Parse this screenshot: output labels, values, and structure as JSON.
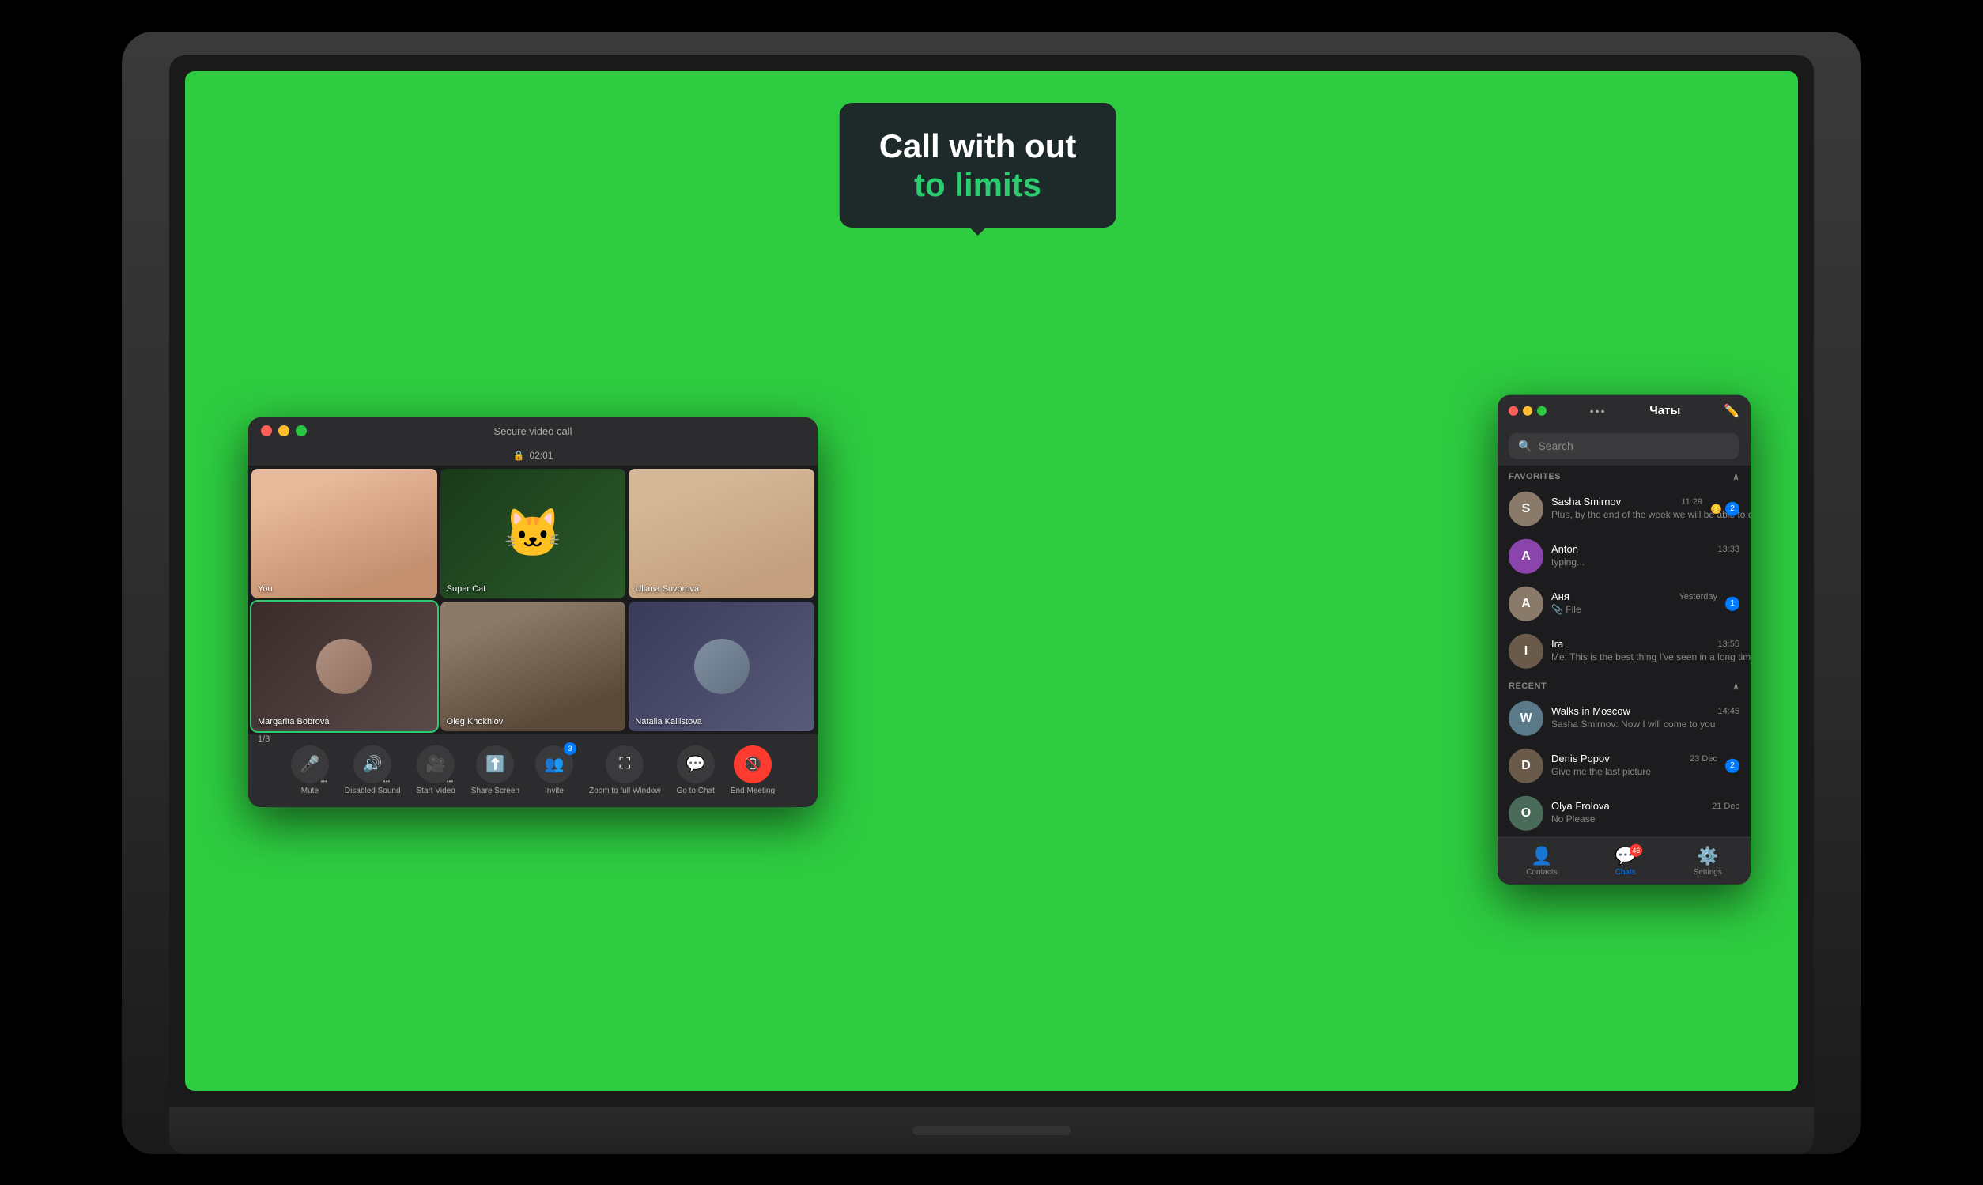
{
  "laptop": {
    "screen_bg": "#2ecc40"
  },
  "tooltip": {
    "line1": "Call with out",
    "line2": "to limits"
  },
  "video_call": {
    "titlebar_title": "Secure video call",
    "timer": "02:01",
    "page_indicator": "1/3",
    "participants": [
      {
        "id": "you",
        "label": "You",
        "type": "face"
      },
      {
        "id": "supercat",
        "label": "Super Cat",
        "type": "cat"
      },
      {
        "id": "uliana",
        "label": "Uliana Suvorova",
        "type": "face"
      },
      {
        "id": "margarita",
        "label": "Margarita Bobrova",
        "type": "avatar"
      },
      {
        "id": "oleg",
        "label": "Oleg Khokhlov",
        "type": "face"
      },
      {
        "id": "natalia",
        "label": "Natalia Kallistova",
        "type": "avatar"
      }
    ],
    "toolbar": {
      "mute_label": "Mute",
      "sound_label": "Disabled Sound",
      "video_label": "Start Video",
      "share_label": "Share Screen",
      "invite_label": "Invite",
      "zoom_label": "Zoom to full Window",
      "chat_label": "Go to Chat",
      "end_label": "End Meeting",
      "invite_badge": "3"
    }
  },
  "chat_sidebar": {
    "title": "Чаты",
    "search_placeholder": "Search",
    "sections": {
      "favorites_label": "FAVORITES",
      "recent_label": "RECENT"
    },
    "contacts": [
      {
        "id": "sasha",
        "name": "Sasha Smirnov",
        "time": "11:29",
        "preview": "Plus, by the end of the week we will be able to discuss what has ...",
        "avatar_color": "#8a7a6a",
        "avatar_text": "S",
        "unread": false,
        "icons": [
          "reaction",
          "unread2"
        ]
      },
      {
        "id": "anton",
        "name": "Anton",
        "time": "13:33",
        "preview": "typing...",
        "avatar_color": "#8b44ac",
        "avatar_text": "A",
        "unread": false
      },
      {
        "id": "anya",
        "name": "Аня",
        "time": "Yesterday",
        "preview": "📎 File",
        "avatar_color": "#8a7a6a",
        "avatar_text": "А",
        "unread": true,
        "unread_count": "1"
      },
      {
        "id": "ira",
        "name": "Ira",
        "time": "13:55",
        "preview": "Me: This is the best thing I've seen in a long time",
        "avatar_color": "#6a5a4a",
        "avatar_text": "I",
        "unread": false
      },
      {
        "id": "walks",
        "name": "Walks in Moscow",
        "time": "14:45",
        "preview": "Sasha Smirnov: Now I will come to you",
        "avatar_color": "#5a7a8a",
        "avatar_text": "W",
        "unread": false
      },
      {
        "id": "denis",
        "name": "Denis Popov",
        "time": "23 Dec",
        "preview": "Give me the last picture",
        "avatar_color": "#6a5a4a",
        "avatar_text": "D",
        "unread": true,
        "unread_count": "2"
      },
      {
        "id": "olya",
        "name": "Olya Frolova",
        "time": "21 Dec",
        "preview": "No Please",
        "avatar_color": "#4a6a5a",
        "avatar_text": "O",
        "unread": false
      }
    ],
    "nav": {
      "contacts_label": "Contacts",
      "chats_label": "Chats",
      "settings_label": "Settings",
      "chats_badge": "46"
    }
  }
}
